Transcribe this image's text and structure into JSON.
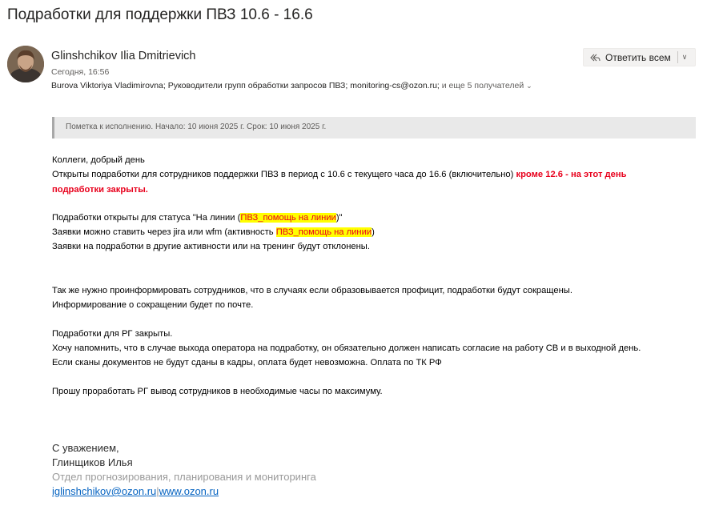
{
  "message": {
    "subject": "Подработки для поддержки ПВЗ 10.6 - 16.6",
    "sender_name": "Glinshchikov Ilia Dmitrievich",
    "date": "Сегодня, 16:56",
    "recipients": [
      "Burova Viktoriya Vladimirovna",
      "Руководители групп обработки запросов ПВЗ",
      "monitoring-cs@ozon.ru"
    ],
    "recipients_more": "и еще 5 получателей",
    "reply_all_label": "Ответить всем",
    "flag_text": "Пометка к исполнению. Начало: 10 июня 2025 г. Срок: 10 июня 2025 г."
  },
  "body": {
    "greeting": "Коллеги, добрый день",
    "l2_text": "Открыты подработки для сотрудников поддержки ПВЗ в период с 10.6 с текущего часа до 16.6 (включительно) ",
    "l2_red": "кроме 12.6 - на этот день",
    "l3_red": "подработки закрыты.",
    "l4_pre": "Подработки открыты для статуса \"На линии (",
    "l4_hl": "ПВЗ_помощь на линии",
    "l4_post": ")\"",
    "l5_pre": "Заявки можно ставить через jira или wfm (активность ",
    "l5_hl": "ПВЗ_помощь на линии",
    "l5_post": ")",
    "l6": "Заявки на подработки в другие активности или на тренинг будут отклонены.",
    "l7": " Так же нужно проинформировать сотрудников, что в случаях если образовывается профицит, подработки будут сокращены.",
    "l8": "Информирование о сокращении будет по почте.",
    "l9": "Подработки для РГ закрыты.",
    "l10": "Хочу напомнить, что в случае выхода оператора на подработку, он обязательно должен написать согласие на работу СВ и в выходной день.",
    "l11": "Если сканы документов не будут сданы в кадры, оплата будет невозможна. Оплата по ТК РФ",
    "l12": "Прошу проработать РГ вывод сотрудников в необходимые часы по максимуму."
  },
  "signature": {
    "regards": "С уважением,",
    "name": "Глинщиков Илья",
    "department": "Отдел прогнозирования, планирования и мониторинга",
    "email": "iglinshchikov@ozon.ru",
    "separator": "|",
    "website": "www.ozon.ru"
  },
  "colors": {
    "accent_red": "#e8001c",
    "highlight": "#ffff00",
    "link": "#0563c1"
  }
}
